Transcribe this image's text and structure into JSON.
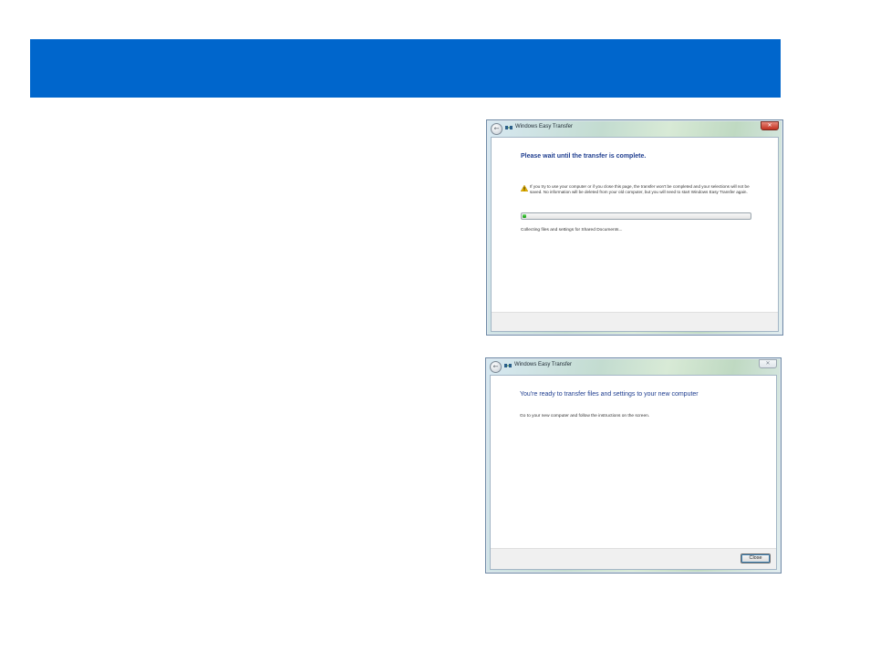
{
  "colors": {
    "banner": "#0066cc",
    "heading": "#1e3d8f",
    "progress": "#2fb52a",
    "warning": "#e8b400"
  },
  "windows": [
    {
      "title": "Windows Easy Transfer",
      "heading": "Please wait until the transfer is complete.",
      "warning_icon": "warning-triangle-icon",
      "warning_text": "If you try to use your computer or if you close this page, the transfer won't be completed and your selections will not be saved. No information will be deleted from your old computer, but you will need to start Windows Easy Transfer again.",
      "progress_fraction": 0.015,
      "status": "Collecting files and settings for Shared Documents..."
    },
    {
      "title": "Windows Easy Transfer",
      "heading": "You're ready to transfer files and settings to your new computer",
      "body": "Go to your new computer and follow the instructions on the screen.",
      "close_button": "Close"
    }
  ]
}
